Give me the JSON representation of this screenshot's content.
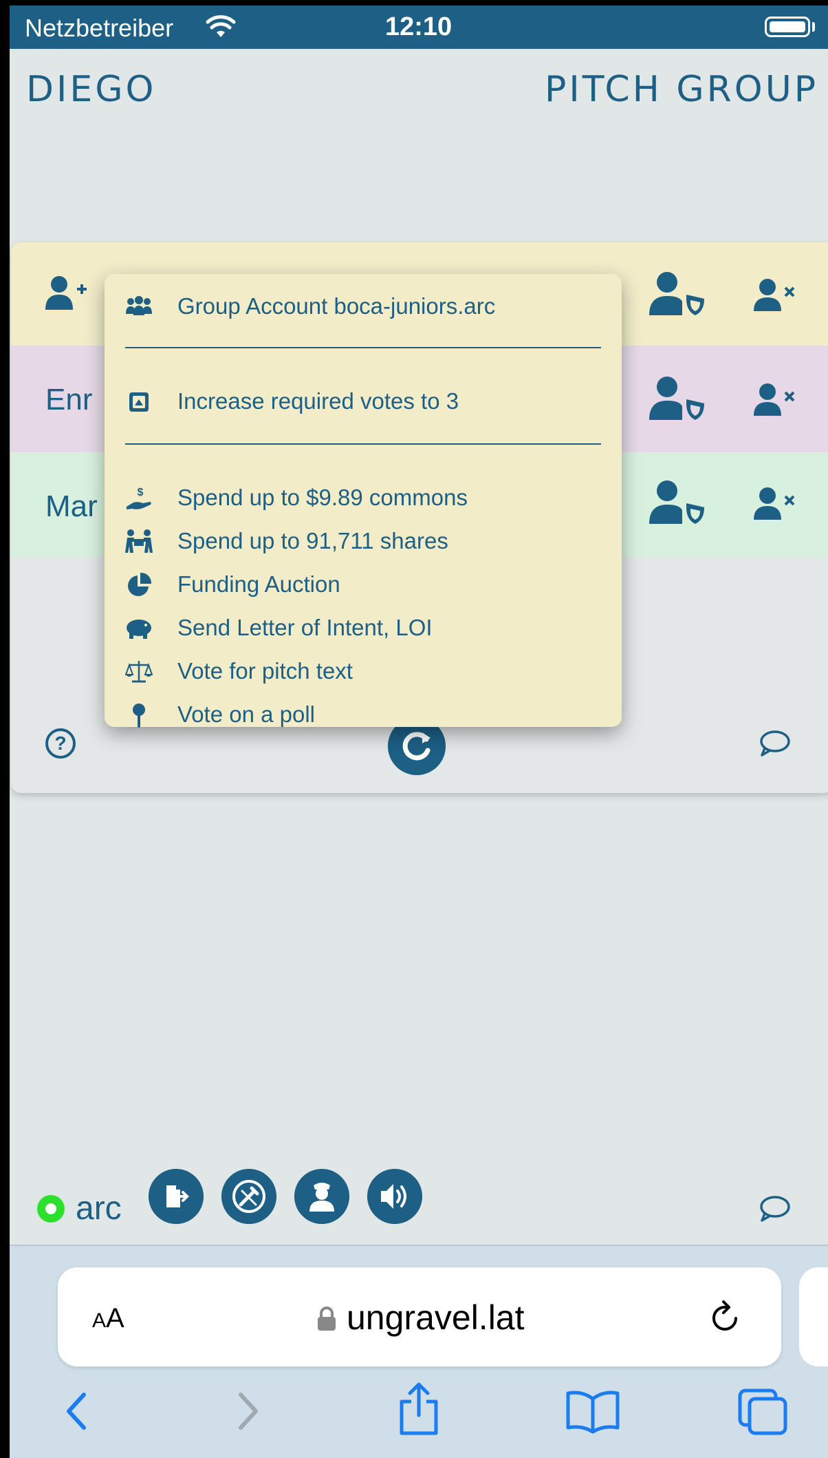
{
  "status_bar": {
    "carrier": "Netzbetreiber",
    "time": "12:10"
  },
  "header": {
    "left": "DIEGO",
    "right": "PITCH GROUP"
  },
  "members": [
    {
      "name": "Enr"
    },
    {
      "name": "Mar"
    }
  ],
  "popup": {
    "items": [
      {
        "label": "Group Account boca-juniors.arc",
        "icon": "group-icon"
      },
      {
        "label": "Increase required votes to 3",
        "icon": "square-up-icon"
      },
      {
        "label": "Spend up to $9.89 commons",
        "icon": "hand-dollar-icon"
      },
      {
        "label": "Spend up to 91,711 shares",
        "icon": "people-carry-icon"
      },
      {
        "label": "Funding Auction",
        "icon": "pie-chart-icon"
      },
      {
        "label": "Send Letter of Intent, LOI",
        "icon": "piggy-icon"
      },
      {
        "label": "Vote for pitch text",
        "icon": "scale-icon"
      },
      {
        "label": "Vote on a poll",
        "icon": "map-pin-icon"
      }
    ]
  },
  "footer": {
    "status_label": "arc"
  },
  "safari": {
    "text_size_small": "A",
    "text_size_large": "A",
    "url": "ungravel.lat"
  },
  "colors": {
    "primary": "#1d5f85",
    "row_yellow": "#f2ecc9",
    "row_purple": "#e6d8e6",
    "row_green": "#d8f1de",
    "status_green": "#2ee02e"
  }
}
